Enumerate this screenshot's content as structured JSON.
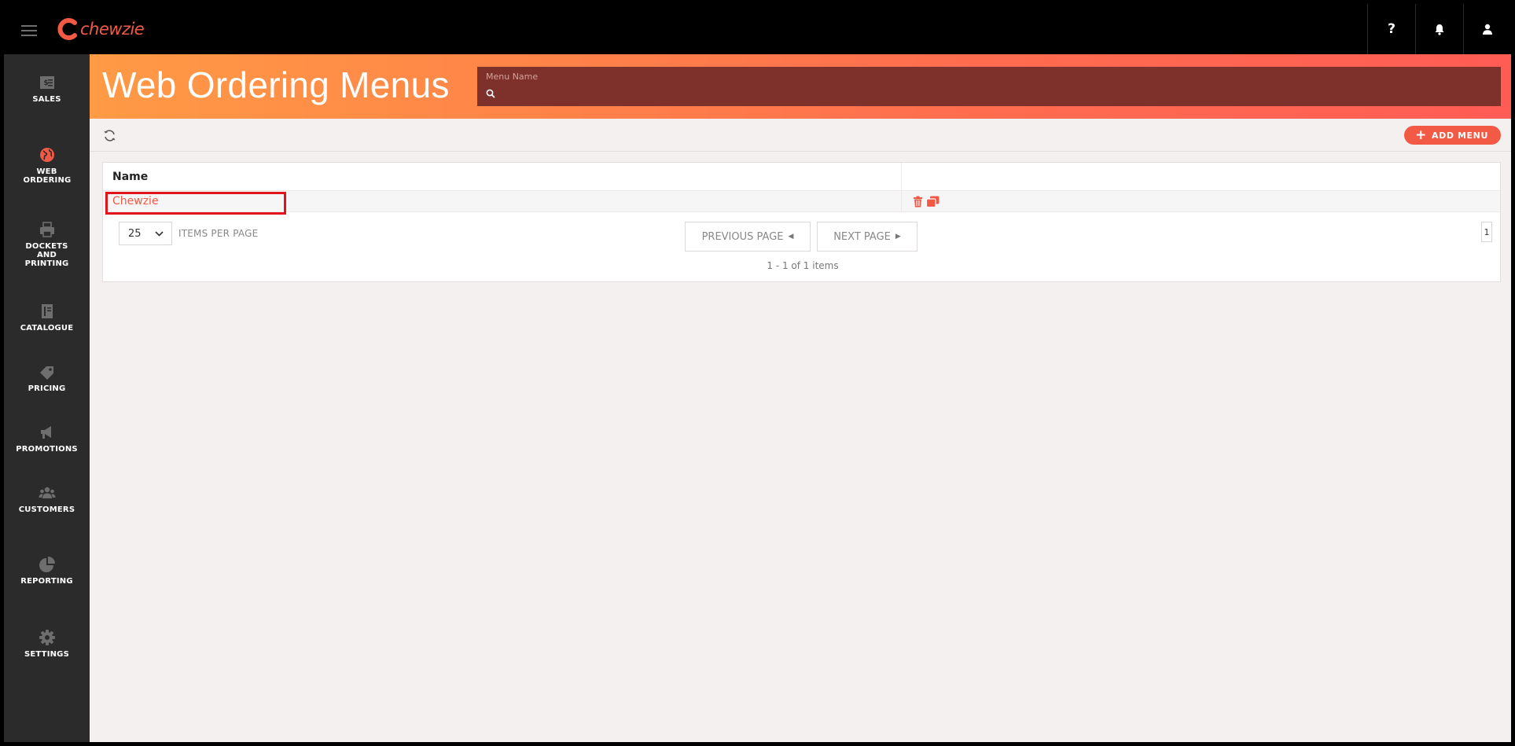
{
  "topbar": {
    "logo_text": "chewzie",
    "help_label": "?"
  },
  "sidebar": {
    "items": [
      {
        "label": "SALES",
        "icon": "sales-icon"
      },
      {
        "label": "WEB ORDERING",
        "icon": "globe-icon"
      },
      {
        "label": "DOCKETS AND PRINTING",
        "icon": "printer-icon"
      },
      {
        "label": "CATALOGUE",
        "icon": "catalogue-icon"
      },
      {
        "label": "PRICING",
        "icon": "price-tag-icon"
      },
      {
        "label": "PROMOTIONS",
        "icon": "megaphone-icon"
      },
      {
        "label": "CUSTOMERS",
        "icon": "users-icon"
      },
      {
        "label": "REPORTING",
        "icon": "pie-chart-icon"
      },
      {
        "label": "SETTINGS",
        "icon": "gear-icon"
      }
    ]
  },
  "header": {
    "title": "Web Ordering Menus",
    "search_label": "Menu Name",
    "search_value": ""
  },
  "toolbar": {
    "add_label": "ADD MENU"
  },
  "table": {
    "columns": [
      "Name",
      ""
    ],
    "rows": [
      {
        "name": "Chewzie"
      }
    ]
  },
  "pager": {
    "per_page": "25",
    "per_page_label": "ITEMS PER PAGE",
    "prev_label": "PREVIOUS PAGE",
    "next_label": "NEXT PAGE",
    "range_text": "1 - 1 of 1 items",
    "current_page": "1"
  },
  "colors": {
    "accent": "#f25a45",
    "sidebar_bg": "#2b2b2b",
    "highlight": "#e0141a"
  }
}
